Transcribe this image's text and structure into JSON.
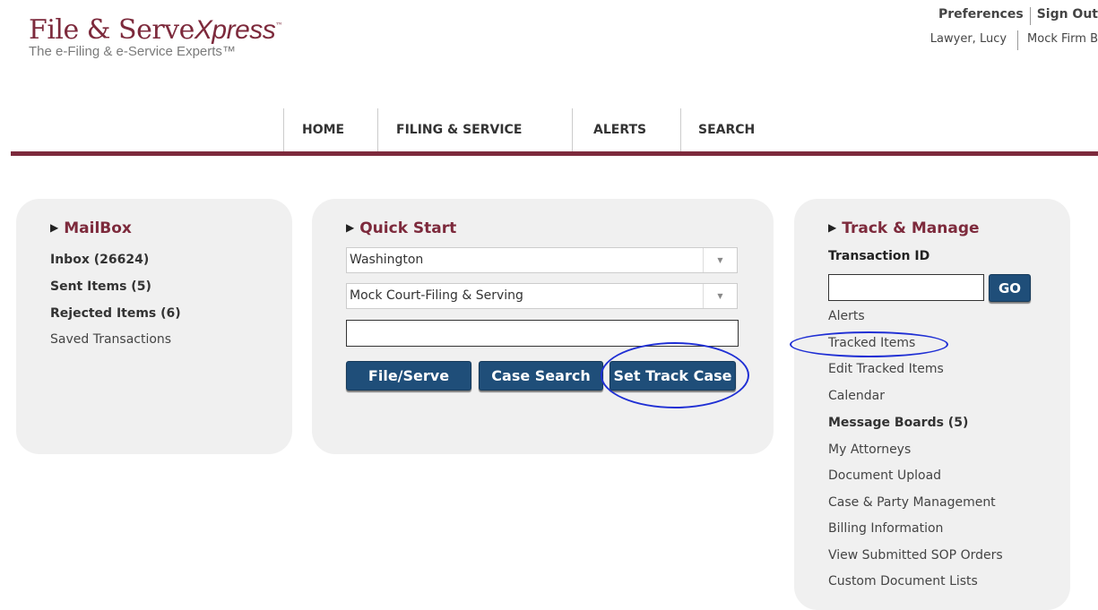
{
  "logo": {
    "part1": "File & Serve",
    "part2": "Xpress",
    "tm": "™",
    "tagline": "The e-Filing & e-Service Experts™"
  },
  "header": {
    "preferences": "Preferences",
    "sign_out": "Sign Out",
    "user_name": "Lawyer, Lucy",
    "firm": "Mock Firm B"
  },
  "nav": {
    "home": "HOME",
    "filing": "FILING & SERVICE",
    "alerts": "ALERTS",
    "search": "SEARCH"
  },
  "mailbox": {
    "title": "MailBox",
    "inbox": "Inbox (26624)",
    "sent": "Sent Items (5)",
    "rejected": "Rejected Items (6)",
    "saved": "Saved Transactions"
  },
  "quickstart": {
    "title": "Quick Start",
    "state_value": "Washington",
    "court_value": "Mock Court-Filing & Serving",
    "search_value": "",
    "file_serve": "File/Serve",
    "case_search": "Case Search",
    "set_track_case": "Set Track Case"
  },
  "track": {
    "title": "Track & Manage",
    "transaction_label": "Transaction ID",
    "transaction_value": "",
    "go": "GO",
    "links": {
      "alerts": "Alerts",
      "tracked": "Tracked Items",
      "edit_tracked": "Edit Tracked Items",
      "calendar": "Calendar",
      "message_boards": "Message Boards (5)",
      "attorneys": "My Attorneys",
      "upload": "Document Upload",
      "case_party": "Case & Party Management",
      "billing": "Billing Information",
      "sop": "View Submitted SOP Orders",
      "custom_docs": "Custom Document Lists"
    }
  },
  "colors": {
    "brand": "#7d2a3c",
    "button": "#1f4e79",
    "annotation": "#1f2fd4",
    "panel": "#f0f0f0"
  }
}
